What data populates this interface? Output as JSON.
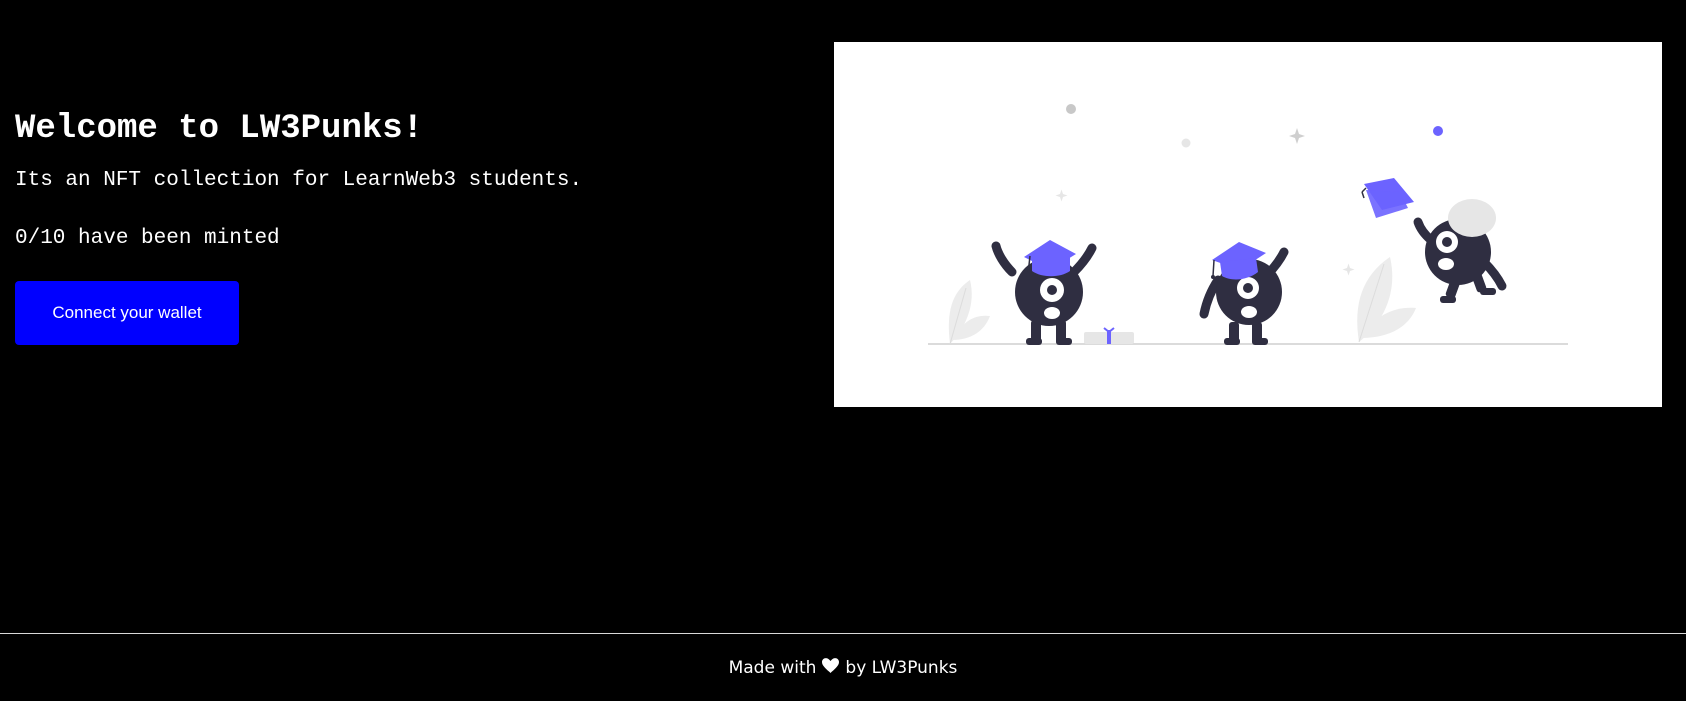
{
  "intro": {
    "title": "Welcome to LW3Punks!",
    "description": "Its an NFT collection for LearnWeb3 students.",
    "minted_status": "0/10 have been minted",
    "connect_button_label": "Connect your wallet"
  },
  "hero": {
    "illustration": "graduation-monsters-illustration",
    "accent_color": "#6c63ff",
    "figure_color": "#2f2e41"
  },
  "footer": {
    "prefix": "Made with",
    "heart_icon": "heart-icon",
    "suffix": "by LW3Punks"
  },
  "colors": {
    "background": "#000000",
    "button": "#0000ff",
    "text": "#ffffff"
  }
}
